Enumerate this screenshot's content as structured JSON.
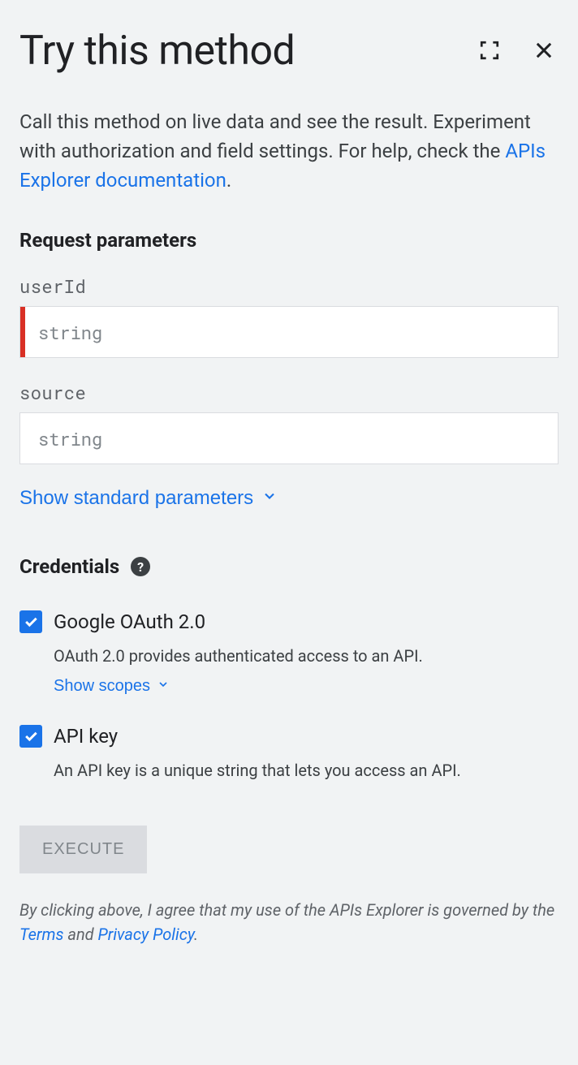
{
  "header": {
    "title": "Try this method"
  },
  "description": {
    "text_before_link": "Call this method on live data and see the result. Experiment with authorization and field settings. For help, check the ",
    "link_text": "APIs Explorer documentation",
    "text_after_link": "."
  },
  "sections": {
    "request_params_heading": "Request parameters",
    "credentials_heading": "Credentials"
  },
  "params": {
    "userId": {
      "label": "userId",
      "placeholder": "string"
    },
    "source": {
      "label": "source",
      "placeholder": "string"
    }
  },
  "toggles": {
    "standard_params": "Show standard parameters",
    "show_scopes": "Show scopes"
  },
  "credentials": {
    "oauth": {
      "label": "Google OAuth 2.0",
      "description": "OAuth 2.0 provides authenticated access to an API."
    },
    "apikey": {
      "label": "API key",
      "description": "An API key is a unique string that lets you access an API."
    }
  },
  "execute": {
    "label": "EXECUTE"
  },
  "footer": {
    "text_before": "By clicking above, I agree that my use of the APIs Explorer is governed by the ",
    "terms_link": "Terms",
    "and_text": " and ",
    "privacy_link": "Privacy Policy",
    "period": "."
  }
}
